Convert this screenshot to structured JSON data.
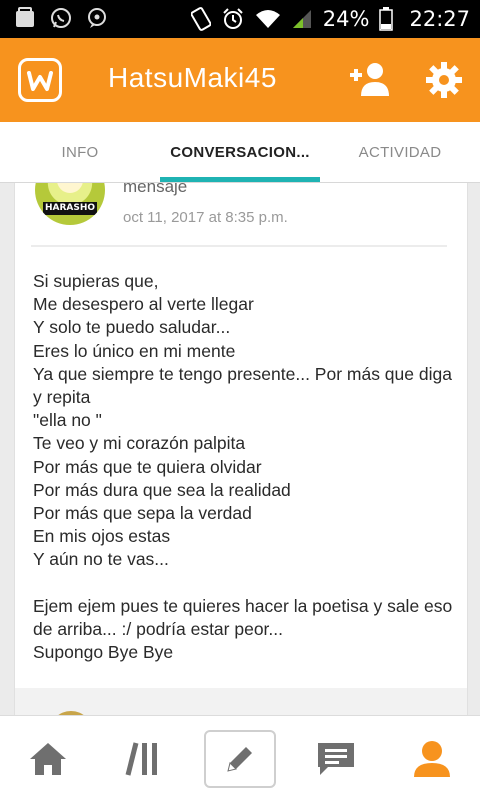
{
  "status_bar": {
    "battery_percent": "24%",
    "time": "22:27"
  },
  "app_bar": {
    "title": "HatsuMaki45",
    "logo_icon": "wattpad-logo-icon",
    "actions": [
      "add-user-icon",
      "gear-icon"
    ]
  },
  "tabs": [
    {
      "label": "INFO",
      "active": false
    },
    {
      "label": "CONVERSACION...",
      "active": true
    },
    {
      "label": "ACTIVIDAD",
      "active": false
    }
  ],
  "message": {
    "avatar_tag": "HARASHO",
    "label": "mensaje",
    "date": "oct 11, 2017 at 8:35 p.m.",
    "lines": [
      "Si supieras que,",
      "Me desespero al verte llegar",
      "Y solo te puedo saludar...",
      "Eres lo único en mi mente",
      "Ya que siempre te tengo presente... Por más que diga y repita",
      "\"ella no \"",
      "Te veo y mi corazón palpita",
      "Por más que te quiera olvidar",
      "Por más dura que sea la realidad",
      "Por más que sepa la verdad",
      "En mis ojos estas",
      "Y aún no te vas...",
      "",
      "Ejem ejem pues te quieres hacer la poetisa y sale eso de arriba... :/ podría estar peor...",
      "Supongo Bye Bye"
    ]
  },
  "bottom_nav": [
    "home-icon",
    "library-icon",
    "write-icon",
    "messages-icon",
    "profile-icon"
  ],
  "colors": {
    "app_bar": "#f7931e",
    "tab_indicator": "#1fb3b3",
    "nav_icon": "#6f6f6f",
    "nav_active": "#f7931e"
  }
}
